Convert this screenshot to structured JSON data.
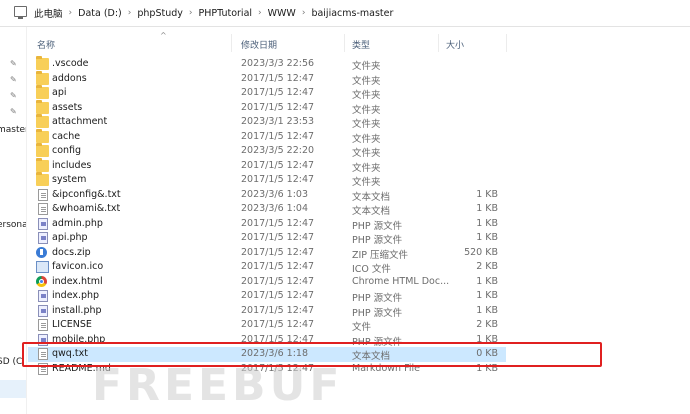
{
  "breadcrumb": [
    "此电脑",
    "Data (D:)",
    "phpStudy",
    "PHPTutorial",
    "WWW",
    "baijiacms-master"
  ],
  "left_pane": {
    "labels": [
      {
        "text": "master"
      },
      {
        "text": "ersona"
      },
      {
        "text": "SD (C"
      }
    ]
  },
  "columns": {
    "name": "名称",
    "date": "修改日期",
    "type": "类型",
    "size": "大小"
  },
  "files": [
    {
      "name": ".vscode",
      "date": "2023/3/3 22:56",
      "type": "文件夹",
      "size": "",
      "icon": "folder-icon"
    },
    {
      "name": "addons",
      "date": "2017/1/5 12:47",
      "type": "文件夹",
      "size": "",
      "icon": "folder-icon"
    },
    {
      "name": "api",
      "date": "2017/1/5 12:47",
      "type": "文件夹",
      "size": "",
      "icon": "folder-icon"
    },
    {
      "name": "assets",
      "date": "2017/1/5 12:47",
      "type": "文件夹",
      "size": "",
      "icon": "folder-icon"
    },
    {
      "name": "attachment",
      "date": "2023/3/1 23:53",
      "type": "文件夹",
      "size": "",
      "icon": "folder-icon"
    },
    {
      "name": "cache",
      "date": "2017/1/5 12:47",
      "type": "文件夹",
      "size": "",
      "icon": "folder-icon"
    },
    {
      "name": "config",
      "date": "2023/3/5 22:20",
      "type": "文件夹",
      "size": "",
      "icon": "folder-icon"
    },
    {
      "name": "includes",
      "date": "2017/1/5 12:47",
      "type": "文件夹",
      "size": "",
      "icon": "folder-icon"
    },
    {
      "name": "system",
      "date": "2017/1/5 12:47",
      "type": "文件夹",
      "size": "",
      "icon": "folder-icon"
    },
    {
      "name": "&ipconfig&.txt",
      "date": "2023/3/6 1:03",
      "type": "文本文档",
      "size": "1 KB",
      "icon": "text-file-icon"
    },
    {
      "name": "&whoami&.txt",
      "date": "2023/3/6 1:04",
      "type": "文本文档",
      "size": "1 KB",
      "icon": "text-file-icon"
    },
    {
      "name": "admin.php",
      "date": "2017/1/5 12:47",
      "type": "PHP 源文件",
      "size": "1 KB",
      "icon": "php-file-icon"
    },
    {
      "name": "api.php",
      "date": "2017/1/5 12:47",
      "type": "PHP 源文件",
      "size": "1 KB",
      "icon": "php-file-icon"
    },
    {
      "name": "docs.zip",
      "date": "2017/1/5 12:47",
      "type": "ZIP 压缩文件",
      "size": "520 KB",
      "icon": "zip-file-icon"
    },
    {
      "name": "favicon.ico",
      "date": "2017/1/5 12:47",
      "type": "ICO 文件",
      "size": "2 KB",
      "icon": "ico-file-icon"
    },
    {
      "name": "index.html",
      "date": "2017/1/5 12:47",
      "type": "Chrome HTML Doc...",
      "size": "1 KB",
      "icon": "chrome-html-icon"
    },
    {
      "name": "index.php",
      "date": "2017/1/5 12:47",
      "type": "PHP 源文件",
      "size": "1 KB",
      "icon": "php-file-icon"
    },
    {
      "name": "install.php",
      "date": "2017/1/5 12:47",
      "type": "PHP 源文件",
      "size": "1 KB",
      "icon": "php-file-icon"
    },
    {
      "name": "LICENSE",
      "date": "2017/1/5 12:47",
      "type": "文件",
      "size": "2 KB",
      "icon": "text-file-icon"
    },
    {
      "name": "mobile.php",
      "date": "2017/1/5 12:47",
      "type": "PHP 源文件",
      "size": "1 KB",
      "icon": "php-file-icon"
    },
    {
      "name": "qwq.txt",
      "date": "2023/3/6 1:18",
      "type": "文本文档",
      "size": "0 KB",
      "icon": "text-file-icon",
      "selected": true
    },
    {
      "name": "README.md",
      "date": "2017/1/5 12:47",
      "type": "Markdown File",
      "size": "1 KB",
      "icon": "text-file-icon"
    }
  ],
  "watermark": "FREEBUF",
  "colors": {
    "selection": "#cce8ff",
    "highlight_box": "#e02020",
    "folder": "#f8cf58"
  }
}
